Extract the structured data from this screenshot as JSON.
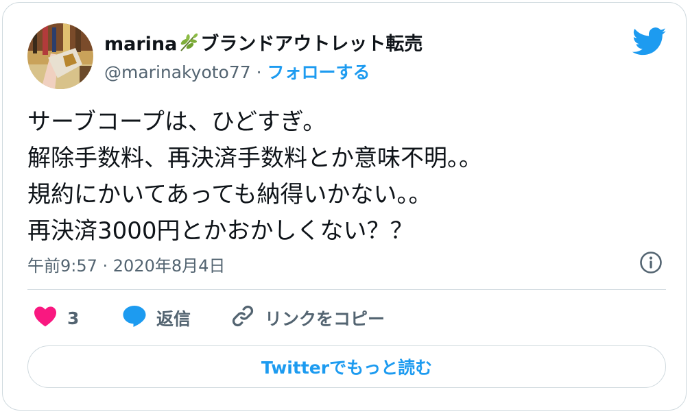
{
  "user": {
    "display_name": "marina",
    "display_name_suffix": "ブランドアウトレット転売",
    "handle": "@marinakyoto77",
    "separator": " · ",
    "follow_label": "フォローする",
    "leaf_icon": "herb-leaf-icon"
  },
  "tweet": {
    "lines": [
      "サーブコープは、ひどすぎ。",
      "解除手数料、再決済手数料とか意味不明。。",
      "規約にかいてあっても納得いかない。。",
      "再決済3000円とかおかしくない？？"
    ],
    "timestamp": "午前9:57 · 2020年8月4日"
  },
  "actions": {
    "like_count": "3",
    "reply_label": "返信",
    "copy_link_label": "リンクをコピー"
  },
  "read_more_label": "Twitterでもっと読む",
  "colors": {
    "accent": "#1d9bf0",
    "like": "#f91880",
    "text": "#0f1419",
    "muted": "#536471",
    "border": "#cfd9de"
  }
}
